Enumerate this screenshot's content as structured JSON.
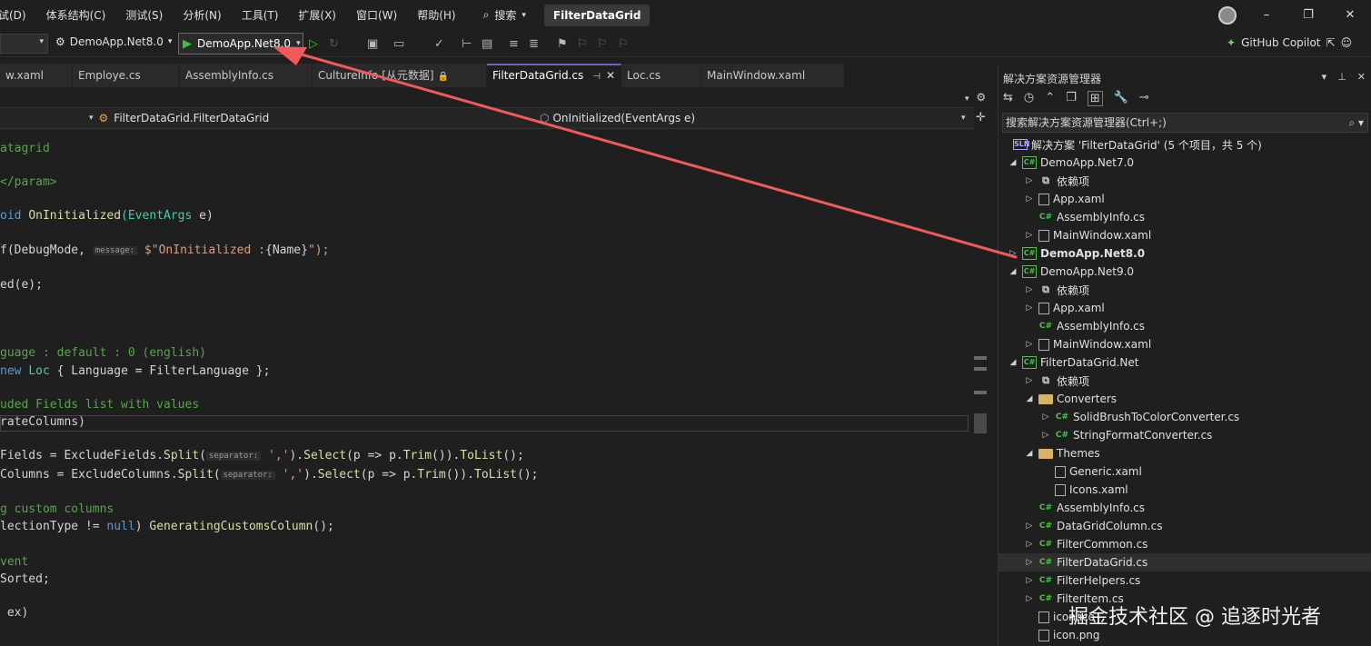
{
  "menubar": {
    "items": [
      "试(D)",
      "体系结构(C)",
      "测试(S)",
      "分析(N)",
      "工具(T)",
      "扩展(X)",
      "窗口(W)",
      "帮助(H)"
    ],
    "search_label": "搜索",
    "solution_title": "FilterDataGrid"
  },
  "window": {
    "minimize": "–",
    "maximize": "❐",
    "close": "✕"
  },
  "toolbar": {
    "startup_project": "DemoApp.Net8.0",
    "run_label": "DemoApp.Net8.0",
    "copilot_label": "GitHub Copilot"
  },
  "tabs": [
    {
      "label": "w.xaml"
    },
    {
      "label": "Employe.cs"
    },
    {
      "label": "AssemblyInfo.cs"
    },
    {
      "label": "CultureInfo [从元数据]"
    },
    {
      "label": "FilterDataGrid.cs"
    },
    {
      "label": "Loc.cs"
    },
    {
      "label": "MainWindow.xaml"
    }
  ],
  "navbar": {
    "type_path": "FilterDataGrid.FilterDataGrid",
    "member": "OnInitialized(EventArgs e)"
  },
  "code": {
    "l1": "atagrid",
    "l2": "</param>",
    "l3a": "oid ",
    "l3b": "OnInitialized",
    "l3c": "(EventArgs",
    "l3d": " e)",
    "l4a": "f(DebugMode, ",
    "l4hint": "message:",
    "l4b": " $\"OnInitialized :",
    "l4c": "{Name}",
    "l4d": "\");",
    "l5": "ed(e);",
    "l6": "guage : default : 0 (english)",
    "l7a": "new ",
    "l7b": "Loc",
    "l7c": " { Language = FilterLanguage };",
    "l8": "uded Fields list with values",
    "l9": "rateColumns)",
    "l10a": "Fields = ExcludeFields.",
    "l10b": "Split",
    "l10c": "(",
    "l10hint": "separator:",
    "l10d": " ','",
    "l10e": ").",
    "l10f": "Select",
    "l10g": "(p => p.",
    "l10h": "Trim",
    "l10i": "()).",
    "l10j": "ToList",
    "l10k": "();",
    "l11a": "Columns = ExcludeColumns.",
    "l11b": "Split",
    "l11c": "(",
    "l11hint": "separator:",
    "l11d": " ','",
    "l11e": ").",
    "l11f": "Select",
    "l11g": "(p => p.",
    "l11h": "Trim",
    "l11i": "()).",
    "l11j": "ToList",
    "l11k": "();",
    "l12": "g custom columns",
    "l13a": "lectionType != ",
    "l13b": "null",
    "l13c": ") ",
    "l13d": "GeneratingCustomsColumn",
    "l13e": "();",
    "l14": "vent",
    "l15": "Sorted;",
    "l16": " ex)"
  },
  "solution_explorer": {
    "title": "解决方案资源管理器",
    "search_placeholder": "搜索解决方案资源管理器(Ctrl+;)",
    "rows": [
      {
        "label": "解决方案 'FilterDataGrid' (5 个项目，共 5 个)"
      },
      {
        "label": "DemoApp.Net7.0"
      },
      {
        "label": "依赖项"
      },
      {
        "label": "App.xaml"
      },
      {
        "label": "AssemblyInfo.cs"
      },
      {
        "label": "MainWindow.xaml"
      },
      {
        "label": "DemoApp.Net8.0"
      },
      {
        "label": "DemoApp.Net9.0"
      },
      {
        "label": "依赖项"
      },
      {
        "label": "App.xaml"
      },
      {
        "label": "AssemblyInfo.cs"
      },
      {
        "label": "MainWindow.xaml"
      },
      {
        "label": "FilterDataGrid.Net"
      },
      {
        "label": "依赖项"
      },
      {
        "label": "Converters"
      },
      {
        "label": "SolidBrushToColorConverter.cs"
      },
      {
        "label": "StringFormatConverter.cs"
      },
      {
        "label": "Themes"
      },
      {
        "label": "Generic.xaml"
      },
      {
        "label": "Icons.xaml"
      },
      {
        "label": "AssemblyInfo.cs"
      },
      {
        "label": "DataGridColumn.cs"
      },
      {
        "label": "FilterCommon.cs"
      },
      {
        "label": "FilterDataGrid.cs"
      },
      {
        "label": "FilterHelpers.cs"
      },
      {
        "label": "FilterItem.cs"
      },
      {
        "label": "icon.ico"
      },
      {
        "label": "icon.png"
      }
    ]
  },
  "watermark": "掘金技术社区 @ 追逐时光者",
  "colors": {
    "accent": "#7b5cc4",
    "run_green": "#3fbf3f",
    "arrow_red": "#f05a5a"
  }
}
